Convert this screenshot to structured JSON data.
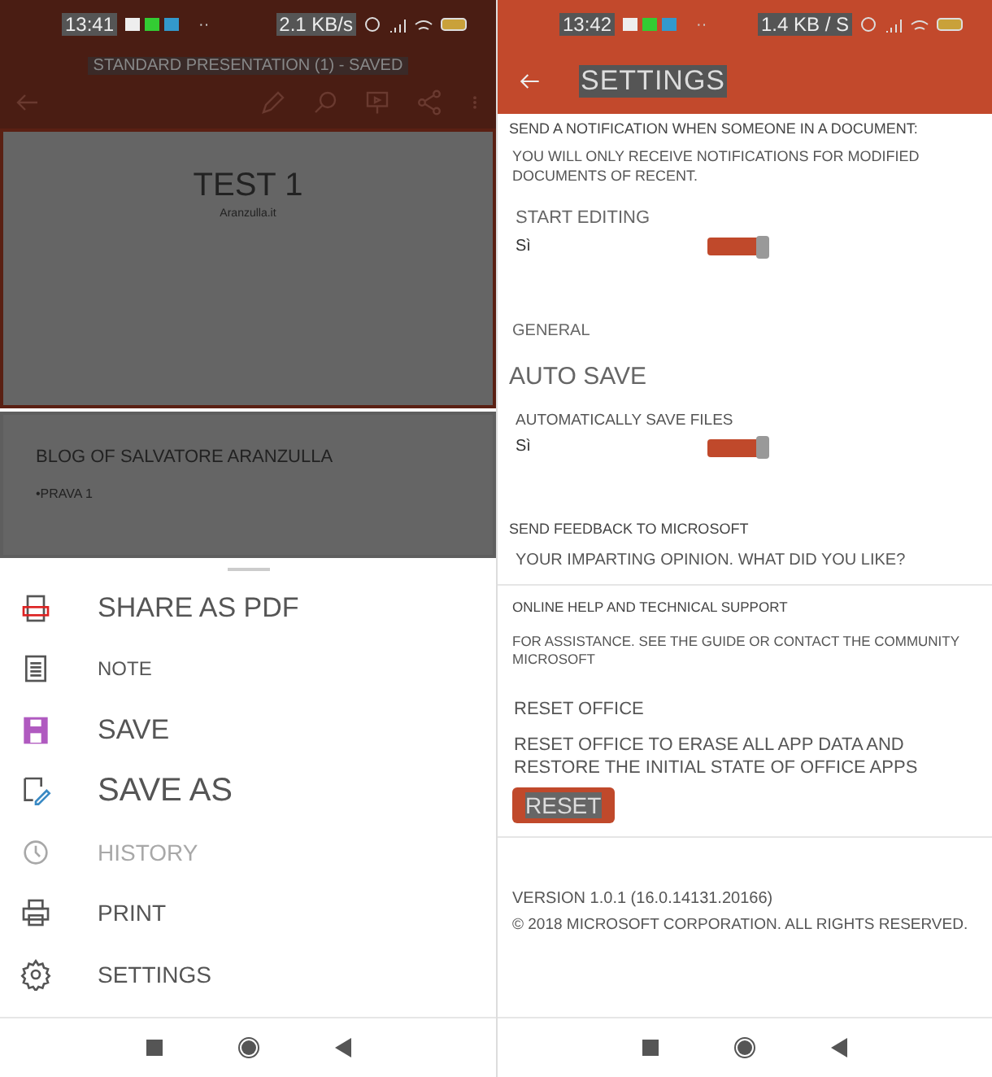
{
  "left": {
    "status_bar": {
      "time": "13:41",
      "more": "··",
      "speed": "2.1 KB/s"
    },
    "document_title": "STANDARD PRESENTATION (1) - SAVED",
    "slides": [
      {
        "title": "TEST 1",
        "subtitle": "Aranzulla.it",
        "selected": true
      },
      {
        "title": "BLOG OF SALVATORE ARANZULLA",
        "subtitle": "•PRAVA 1",
        "selected": false
      }
    ],
    "menu": [
      {
        "label": "SHARE AS PDF",
        "disabled": false
      },
      {
        "label": "NOTE",
        "disabled": false
      },
      {
        "label": "SAVE",
        "disabled": false
      },
      {
        "label": "SAVE AS",
        "disabled": false
      },
      {
        "label": "HISTORY",
        "disabled": true
      },
      {
        "label": "PRINT",
        "disabled": false
      },
      {
        "label": "SETTINGS",
        "disabled": false
      }
    ]
  },
  "right": {
    "status_bar": {
      "time": "13:42",
      "more": "··",
      "speed": "1.4 KB / S"
    },
    "title": "SETTINGS",
    "notification_heading": "SEND A NOTIFICATION WHEN SOMEONE IN A DOCUMENT:",
    "notification_note": "YOU WILL ONLY RECEIVE NOTIFICATIONS FOR MODIFIED DOCUMENTS OF RECENT.",
    "start_editing": {
      "label": "START EDITING",
      "value": "Sì",
      "on": true
    },
    "general_heading": "GENERAL",
    "auto_save_heading": "AUTO SAVE",
    "auto_save": {
      "label": "AUTOMATICALLY SAVE FILES",
      "value": "Sì",
      "on": true
    },
    "feedback": {
      "heading": "SEND FEEDBACK TO MICROSOFT",
      "text": "YOUR IMPARTING OPINION. WHAT DID YOU LIKE?"
    },
    "help": {
      "heading": "ONLINE HELP AND TECHNICAL SUPPORT",
      "text": "FOR ASSISTANCE. SEE THE GUIDE OR CONTACT THE COMMUNITY MICROSOFT"
    },
    "reset": {
      "heading": "RESET OFFICE",
      "text": "RESET OFFICE TO ERASE ALL APP DATA AND RESTORE THE INITIAL STATE OF OFFICE APPS",
      "button": "RESET"
    },
    "version": "VERSION 1.0.1 (16.0.14131.20166)",
    "copyright": "© 2018 MICROSOFT CORPORATION. ALL RIGHTS RESERVED."
  }
}
